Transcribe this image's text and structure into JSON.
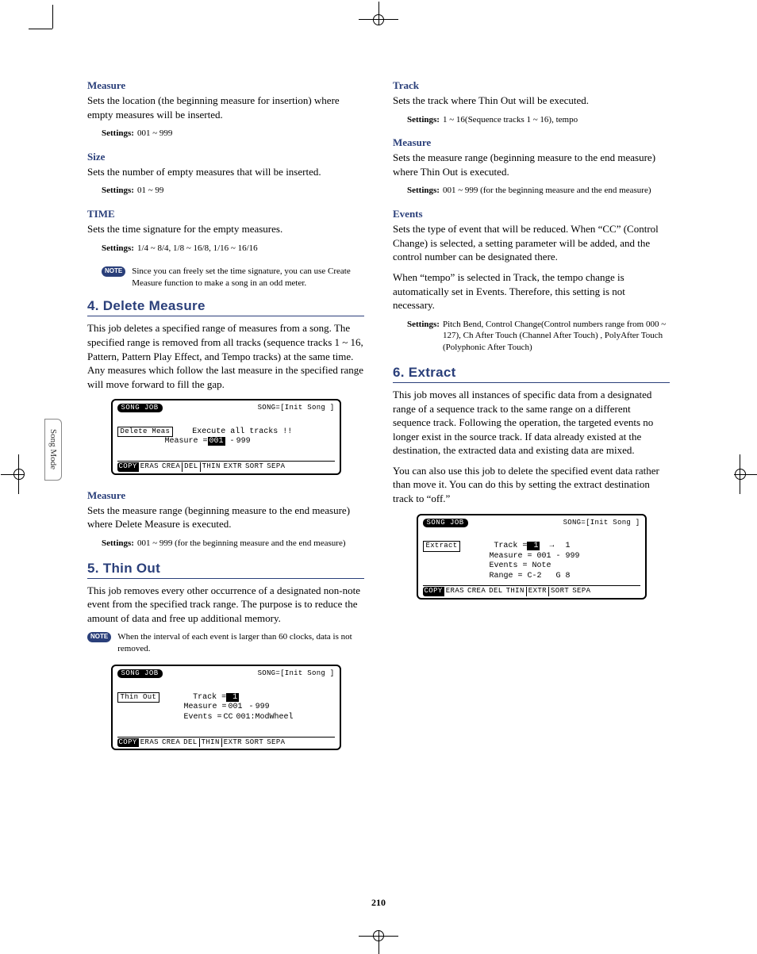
{
  "sideTab": "Song Mode",
  "pageNumber": "210",
  "noteBadge": "NOTE",
  "settingsLabel": "Settings:",
  "left": {
    "measure": {
      "title": "Measure",
      "body": "Sets the location (the beginning measure for insertion) where empty measures will be inserted.",
      "settings": "001 ~ 999"
    },
    "size": {
      "title": "Size",
      "body": "Sets the number of empty measures that will be inserted.",
      "settings": "01 ~ 99"
    },
    "time": {
      "title": "TIME",
      "body": "Sets the time signature for the empty measures.",
      "settings": "1/4 ~ 8/4, 1/8 ~ 16/8, 1/16 ~ 16/16",
      "note": "Since you can freely set the time signature, you can use Create Measure function to make a song in an odd meter."
    },
    "section4": {
      "heading": "4. Delete Measure",
      "body": "This job deletes a specified range of measures from a song. The specified range is removed from all tracks (sequence tracks 1 ~ 16, Pattern, Pattern Play Effect, and Tempo tracks) at the same time. Any measures which follow the last measure in the specified range will move forward to fill the gap.",
      "lcd": {
        "tab": "SONG JOB",
        "song": "SONG=[Init Song ]",
        "box": "Delete Meas",
        "line1": "Execute all tracks !!",
        "line2": "Measure =",
        "v1": "001",
        "dash": " -",
        "v2": "999",
        "tabs": [
          "COPY",
          "ERAS",
          "CREA",
          "DEL",
          "THIN",
          "EXTR",
          "SORT",
          "SEPA"
        ],
        "selected": 3
      },
      "measure": {
        "title": "Measure",
        "body": "Sets the measure range (beginning measure to the end measure) where Delete Measure is executed.",
        "settings": "001 ~ 999 (for the beginning measure and the end measure)"
      }
    },
    "section5": {
      "heading": "5. Thin Out",
      "body": "This job removes every other occurrence of a designated non-note event from the specified track range. The purpose is to reduce the amount of data and free up additional memory.",
      "note": "When the interval of each event is larger than 60 clocks, data is not removed.",
      "lcd": {
        "tab": "SONG JOB",
        "song": "SONG=[Init Song ]",
        "box": "Thin Out",
        "l1a": "Track =",
        "l1v": " 1",
        "l2a": "Measure =",
        "l2v1": "001",
        "l2dash": " -",
        "l2v2": "999",
        "l3a": "Events =",
        "l3v": "CC",
        "l3b": "001:ModWheel",
        "tabs": [
          "COPY",
          "ERAS",
          "CREA",
          "DEL",
          "THIN",
          "EXTR",
          "SORT",
          "SEPA"
        ],
        "selected": 4
      }
    }
  },
  "right": {
    "track": {
      "title": "Track",
      "body": "Sets the track where Thin Out will be executed.",
      "settings": "1 ~ 16(Sequence tracks 1 ~ 16), tempo"
    },
    "measure": {
      "title": "Measure",
      "body": "Sets the measure range (beginning measure to the end measure) where Thin Out is executed.",
      "settings": "001 ~ 999 (for the beginning measure and the end measure)"
    },
    "events": {
      "title": "Events",
      "body1": "Sets the type of event that will be reduced. When “CC” (Control Change) is selected, a setting parameter will be added, and the control number can be designated there.",
      "body2": "When “tempo” is selected in Track, the tempo change is automatically set in Events. Therefore, this setting is not necessary.",
      "settings": "Pitch Bend, Control Change(Control numbers range from 000 ~ 127), Ch After Touch (Channel After Touch) , PolyAfter Touch (Polyphonic After Touch)"
    },
    "section6": {
      "heading": "6. Extract",
      "body1": "This job moves all instances of specific data from a designated range of a sequence track to the same range on a different sequence track. Following the operation, the targeted events no longer exist in the source track. If data already existed at the destination, the extracted data and existing data are mixed.",
      "body2": "You can also use this job to delete the specified event data rather than move it. You can do this by setting the extract destination track to “off.”",
      "lcd": {
        "tab": "SONG JOB",
        "song": "SONG=[Init Song ]",
        "box": "Extract",
        "l1a": "Track =",
        "l1v": " 1",
        "l1arrow": "  →",
        "l1v2": "  1",
        "l2": "Measure = 001 - 999",
        "l3": "Events = Note",
        "l4": "Range = C-2   G 8",
        "tabs": [
          "COPY",
          "ERAS",
          "CREA",
          "DEL",
          "THIN",
          "EXTR",
          "SORT",
          "SEPA"
        ],
        "selected": 5
      }
    }
  }
}
